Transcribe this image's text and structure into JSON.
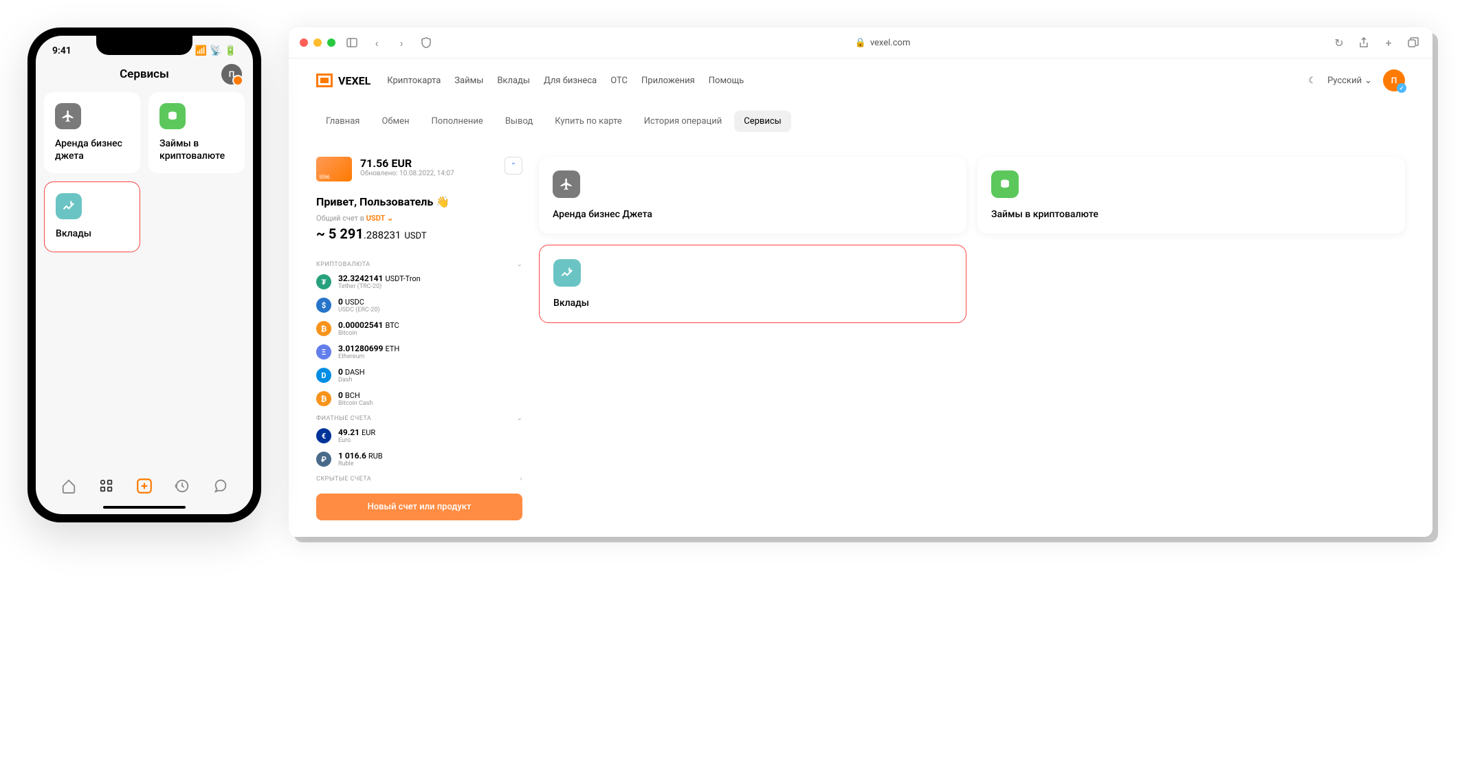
{
  "phone": {
    "time": "9:41",
    "title": "Сервисы",
    "avatar_letter": "П",
    "cards": [
      {
        "title": "Аренда бизнес джета",
        "icon": "plane"
      },
      {
        "title": "Займы в криптовалюте",
        "icon": "coins"
      },
      {
        "title": "Вклады",
        "icon": "chart",
        "highlighted": true
      }
    ]
  },
  "browser": {
    "url": "vexel.com",
    "logo": "VEXEL",
    "nav": [
      "Криптокарта",
      "Займы",
      "Вклады",
      "Для бизнеса",
      "OTC",
      "Приложения",
      "Помощь"
    ],
    "language": "Русский",
    "avatar_letter": "П",
    "sub_nav": [
      "Главная",
      "Обмен",
      "Пополнение",
      "Вывод",
      "Купить по карте",
      "История операций",
      "Сервисы"
    ],
    "sub_nav_active": 6,
    "balance": {
      "amount": "71.56 EUR",
      "updated": "Обновлено: 10.08.2022, 14:07",
      "card_number": "5596"
    },
    "greeting": "Привет, Пользователь 👋",
    "total": {
      "label": "Общий счет в",
      "currency": "USDT",
      "prefix": "~ 5 291",
      "decimal": ".288231",
      "unit": "USDT"
    },
    "sections": {
      "crypto_label": "КРИПТОВАЛЮТА",
      "fiat_label": "ФИАТНЫЕ СЧЕТА",
      "hidden_label": "СКРЫТЫЕ СЧЕТА"
    },
    "crypto": [
      {
        "amount": "32.3242141",
        "unit": "USDT-Tron",
        "name": "Tether (TRC-20)",
        "color": "#26a17b",
        "sym": "₮"
      },
      {
        "amount": "0",
        "unit": "USDC",
        "name": "USDC (ERC-20)",
        "color": "#2775ca",
        "sym": "$"
      },
      {
        "amount": "0.00002541",
        "unit": "BTC",
        "name": "Bitcoin",
        "color": "#f7931a",
        "sym": "₿"
      },
      {
        "amount": "3.01280699",
        "unit": "ETH",
        "name": "Ethereum",
        "color": "#627eea",
        "sym": "Ξ"
      },
      {
        "amount": "0",
        "unit": "DASH",
        "name": "Dash",
        "color": "#008de4",
        "sym": "D"
      },
      {
        "amount": "0",
        "unit": "BCH",
        "name": "Bitcoin Cash",
        "color": "#f7931a",
        "sym": "₿"
      }
    ],
    "fiat": [
      {
        "amount": "49.21",
        "unit": "EUR",
        "name": "Euro",
        "color": "#003399",
        "sym": "€"
      },
      {
        "amount": "1 016.6",
        "unit": "RUB",
        "name": "Ruble",
        "color": "#4a6a8a",
        "sym": "₽"
      }
    ],
    "new_account_btn": "Новый счет или продукт",
    "services": [
      {
        "title": "Аренда бизнес Джета",
        "icon": "plane"
      },
      {
        "title": "Займы в криптовалюте",
        "icon": "coins"
      },
      {
        "title": "Вклады",
        "icon": "chart",
        "highlighted": true
      }
    ]
  }
}
